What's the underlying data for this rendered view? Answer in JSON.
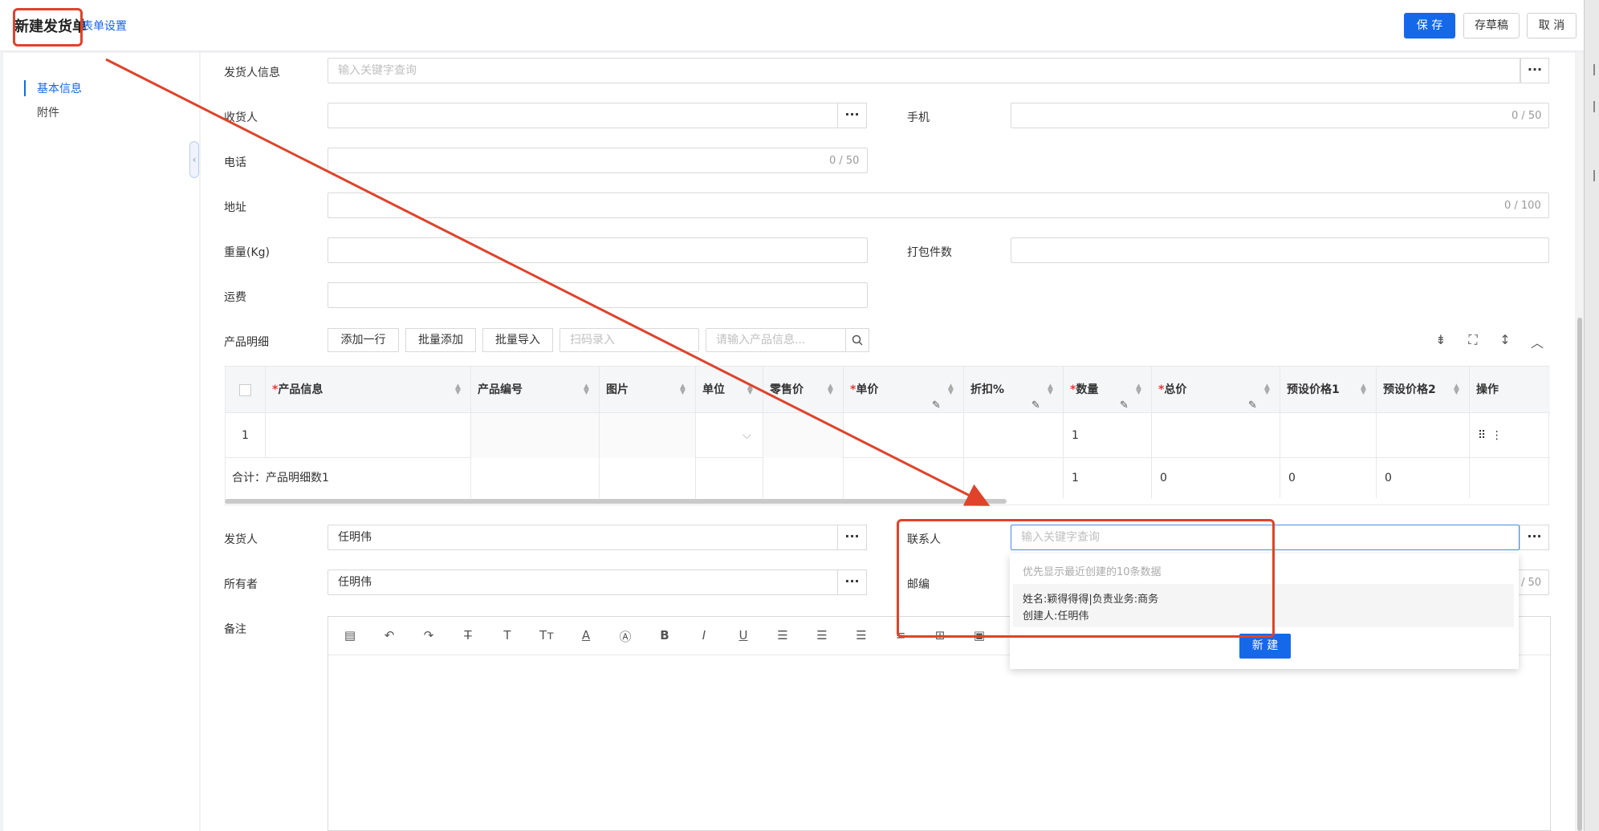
{
  "header": {
    "title": "新建发货单",
    "form_settings": "表单设置",
    "save": "保 存",
    "draft": "存草稿",
    "cancel": "取 消"
  },
  "sidebar": {
    "items": [
      {
        "label": "基本信息",
        "active": true
      },
      {
        "label": "附件",
        "active": false
      }
    ],
    "collapse_icon": "chevron-left-icon"
  },
  "form": {
    "sender_info": {
      "label": "发货人信息",
      "placeholder": "输入关键字查询"
    },
    "receiver": {
      "label": "收货人",
      "value": ""
    },
    "mobile": {
      "label": "手机",
      "counter": "0 / 50"
    },
    "phone": {
      "label": "电话",
      "counter": "0 / 50"
    },
    "address": {
      "label": "地址",
      "counter": "0 / 100"
    },
    "weight": {
      "label": "重量(Kg)"
    },
    "pack_count": {
      "label": "打包件数"
    },
    "freight": {
      "label": "运费"
    },
    "sender": {
      "label": "发货人",
      "value": "任明伟"
    },
    "contact": {
      "label": "联系人",
      "placeholder": "输入关键字查询"
    },
    "owner": {
      "label": "所有者",
      "value": "任明伟"
    },
    "zip": {
      "label": "邮编",
      "counter": "/ 50"
    },
    "remark": {
      "label": "备注"
    }
  },
  "products": {
    "label": "产品明细",
    "buttons": {
      "add_row": "添加一行",
      "batch_add": "批量添加",
      "batch_import": "批量导入"
    },
    "scan_placeholder": "扫码录入",
    "search_placeholder": "请输入产品信息...",
    "columns": [
      {
        "label": "产品信息",
        "required": true
      },
      {
        "label": "产品编号",
        "required": false
      },
      {
        "label": "图片",
        "required": false
      },
      {
        "label": "单位",
        "required": false
      },
      {
        "label": "零售价",
        "required": false
      },
      {
        "label": "单价",
        "required": true
      },
      {
        "label": "折扣%",
        "required": false
      },
      {
        "label": "数量",
        "required": true
      },
      {
        "label": "总价",
        "required": true
      },
      {
        "label": "预设价格1",
        "required": false
      },
      {
        "label": "预设价格2",
        "required": false
      },
      {
        "label": "操作",
        "required": false
      }
    ],
    "rows": [
      {
        "index": "1",
        "quantity": "1"
      }
    ],
    "summary": {
      "label": "合计：产品明细数1",
      "quantity": "1",
      "total": "0",
      "preset1": "0",
      "preset2": "0"
    }
  },
  "dropdown": {
    "hint": "优先显示最近创建的10条数据",
    "option_line1": "姓名:颖得得得|负责业务:商务",
    "option_line2": "创建人:任明伟",
    "new_button": "新 建"
  },
  "editor_toolbar": [
    "template-icon",
    "undo-icon",
    "redo-icon",
    "strikethrough-icon",
    "font-icon",
    "font-size-icon",
    "font-color-icon",
    "background-color-icon",
    "bold-icon",
    "italic-icon",
    "underline-icon",
    "align-left-icon",
    "align-center-icon",
    "align-right-icon",
    "list-icon",
    "table-icon",
    "image-icon"
  ],
  "colors": {
    "primary": "#1569e8",
    "annotation": "#e0422a",
    "required": "#e53935"
  }
}
